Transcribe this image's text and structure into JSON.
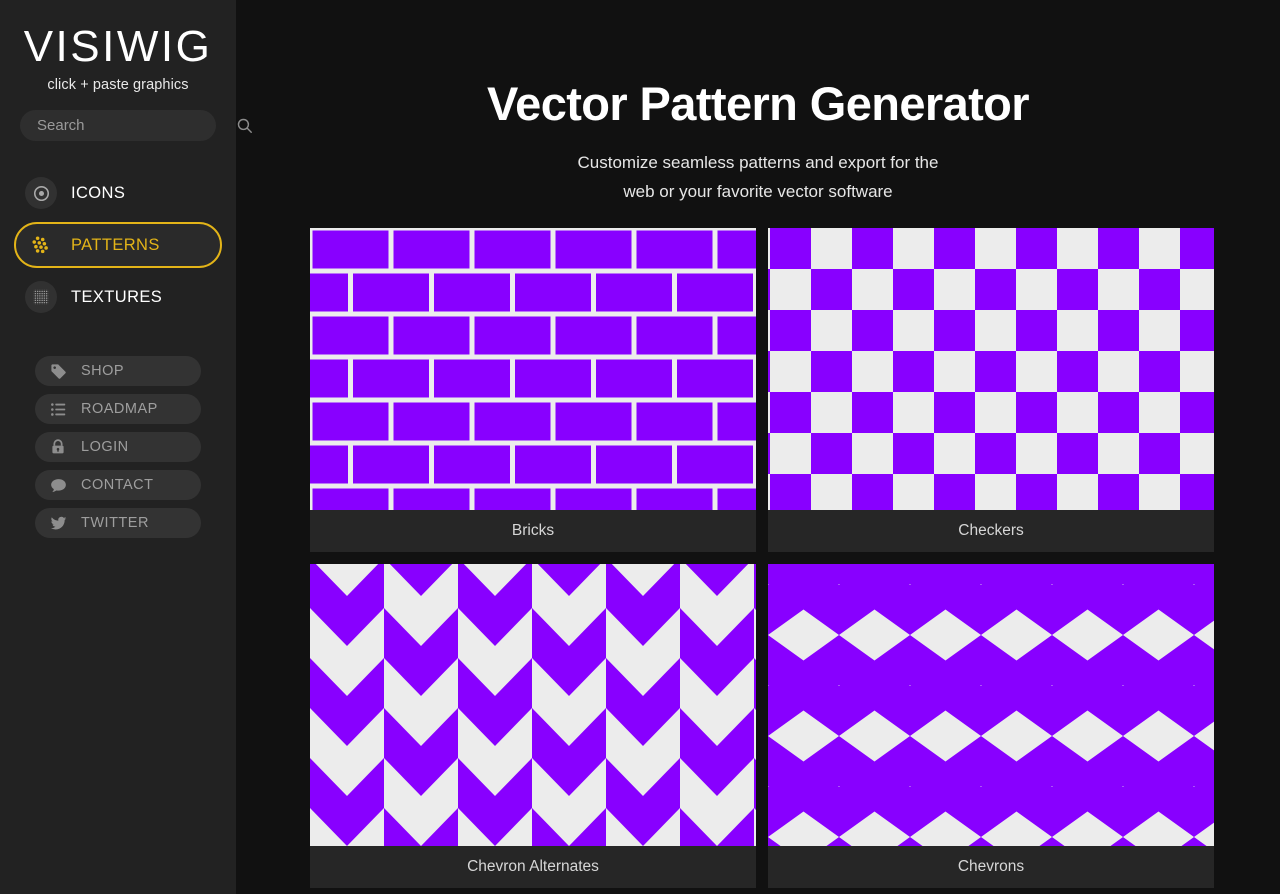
{
  "sidebar": {
    "logo": "VISIWIG",
    "tagline": "click + paste graphics",
    "search": {
      "value": "",
      "placeholder": "Search",
      "icon": "search-icon"
    },
    "main_nav": [
      {
        "label": "ICONS",
        "icon": "target-icon",
        "active": false
      },
      {
        "label": "PATTERNS",
        "icon": "dots-cluster-icon",
        "active": true
      },
      {
        "label": "TEXTURES",
        "icon": "dot-grid-icon",
        "active": false
      }
    ],
    "util_nav": [
      {
        "label": "SHOP",
        "icon": "tag-icon"
      },
      {
        "label": "ROADMAP",
        "icon": "list-icon"
      },
      {
        "label": "LOGIN",
        "icon": "lock-icon"
      },
      {
        "label": "CONTACT",
        "icon": "speech-bubble-icon"
      },
      {
        "label": "TWITTER",
        "icon": "twitter-bird-icon"
      }
    ]
  },
  "header": {
    "title": "Vector Pattern Generator",
    "subtitle_line1": "Customize seamless patterns and export for the",
    "subtitle_line2": "web or your favorite vector software"
  },
  "colors": {
    "accent_purple": "#8800ff",
    "pattern_bg": "#ececec",
    "active_gold": "#e3b418",
    "sidebar_bg": "#222222",
    "page_bg": "#111111",
    "card_bg": "#262626"
  },
  "patterns": [
    {
      "label": "Bricks",
      "id": "bricks"
    },
    {
      "label": "Checkers",
      "id": "checkers"
    },
    {
      "label": "Chevron Alternates",
      "id": "chevron-alternates"
    },
    {
      "label": "Chevrons",
      "id": "chevrons"
    }
  ]
}
